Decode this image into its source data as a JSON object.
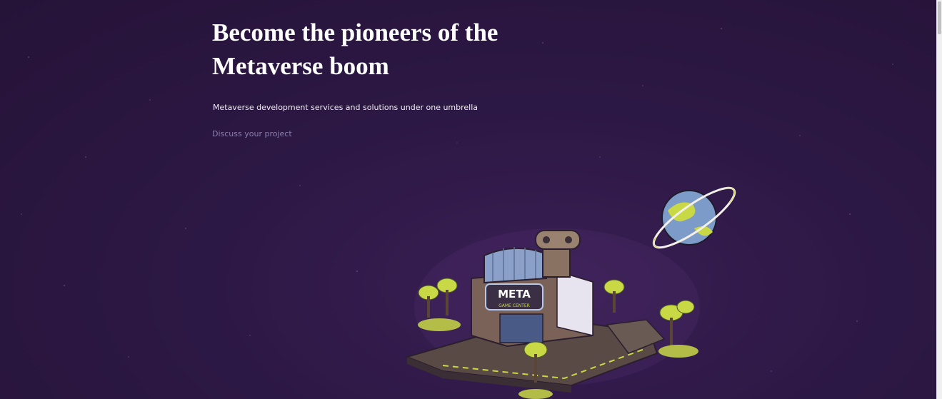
{
  "hero": {
    "title": "Become the pioneers of the\nMetaverse boom",
    "subtitle": "Metaverse development services and solutions under one umbrella",
    "cta": "Discuss your project"
  },
  "illustration": {
    "sign_title": "META",
    "sign_subtitle": "GAME CENTER"
  },
  "colors": {
    "background": "#2c1844",
    "title": "#ffffff",
    "cta": "#8d7fae",
    "accent_lime": "#c9d845"
  }
}
